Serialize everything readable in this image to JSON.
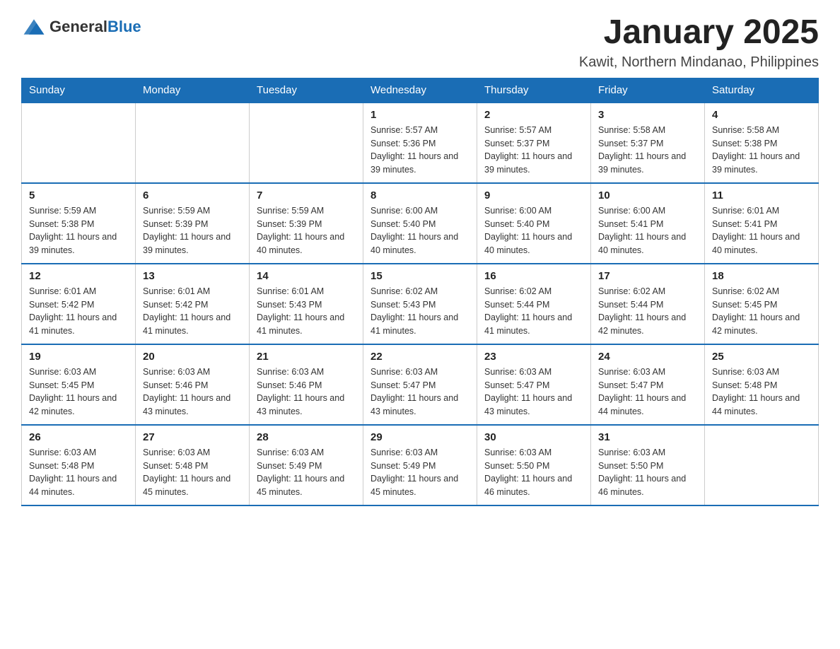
{
  "header": {
    "logo_general": "General",
    "logo_blue": "Blue",
    "month_title": "January 2025",
    "location": "Kawit, Northern Mindanao, Philippines"
  },
  "weekdays": [
    "Sunday",
    "Monday",
    "Tuesday",
    "Wednesday",
    "Thursday",
    "Friday",
    "Saturday"
  ],
  "weeks": [
    [
      {
        "day": "",
        "info": ""
      },
      {
        "day": "",
        "info": ""
      },
      {
        "day": "",
        "info": ""
      },
      {
        "day": "1",
        "info": "Sunrise: 5:57 AM\nSunset: 5:36 PM\nDaylight: 11 hours and 39 minutes."
      },
      {
        "day": "2",
        "info": "Sunrise: 5:57 AM\nSunset: 5:37 PM\nDaylight: 11 hours and 39 minutes."
      },
      {
        "day": "3",
        "info": "Sunrise: 5:58 AM\nSunset: 5:37 PM\nDaylight: 11 hours and 39 minutes."
      },
      {
        "day": "4",
        "info": "Sunrise: 5:58 AM\nSunset: 5:38 PM\nDaylight: 11 hours and 39 minutes."
      }
    ],
    [
      {
        "day": "5",
        "info": "Sunrise: 5:59 AM\nSunset: 5:38 PM\nDaylight: 11 hours and 39 minutes."
      },
      {
        "day": "6",
        "info": "Sunrise: 5:59 AM\nSunset: 5:39 PM\nDaylight: 11 hours and 39 minutes."
      },
      {
        "day": "7",
        "info": "Sunrise: 5:59 AM\nSunset: 5:39 PM\nDaylight: 11 hours and 40 minutes."
      },
      {
        "day": "8",
        "info": "Sunrise: 6:00 AM\nSunset: 5:40 PM\nDaylight: 11 hours and 40 minutes."
      },
      {
        "day": "9",
        "info": "Sunrise: 6:00 AM\nSunset: 5:40 PM\nDaylight: 11 hours and 40 minutes."
      },
      {
        "day": "10",
        "info": "Sunrise: 6:00 AM\nSunset: 5:41 PM\nDaylight: 11 hours and 40 minutes."
      },
      {
        "day": "11",
        "info": "Sunrise: 6:01 AM\nSunset: 5:41 PM\nDaylight: 11 hours and 40 minutes."
      }
    ],
    [
      {
        "day": "12",
        "info": "Sunrise: 6:01 AM\nSunset: 5:42 PM\nDaylight: 11 hours and 41 minutes."
      },
      {
        "day": "13",
        "info": "Sunrise: 6:01 AM\nSunset: 5:42 PM\nDaylight: 11 hours and 41 minutes."
      },
      {
        "day": "14",
        "info": "Sunrise: 6:01 AM\nSunset: 5:43 PM\nDaylight: 11 hours and 41 minutes."
      },
      {
        "day": "15",
        "info": "Sunrise: 6:02 AM\nSunset: 5:43 PM\nDaylight: 11 hours and 41 minutes."
      },
      {
        "day": "16",
        "info": "Sunrise: 6:02 AM\nSunset: 5:44 PM\nDaylight: 11 hours and 41 minutes."
      },
      {
        "day": "17",
        "info": "Sunrise: 6:02 AM\nSunset: 5:44 PM\nDaylight: 11 hours and 42 minutes."
      },
      {
        "day": "18",
        "info": "Sunrise: 6:02 AM\nSunset: 5:45 PM\nDaylight: 11 hours and 42 minutes."
      }
    ],
    [
      {
        "day": "19",
        "info": "Sunrise: 6:03 AM\nSunset: 5:45 PM\nDaylight: 11 hours and 42 minutes."
      },
      {
        "day": "20",
        "info": "Sunrise: 6:03 AM\nSunset: 5:46 PM\nDaylight: 11 hours and 43 minutes."
      },
      {
        "day": "21",
        "info": "Sunrise: 6:03 AM\nSunset: 5:46 PM\nDaylight: 11 hours and 43 minutes."
      },
      {
        "day": "22",
        "info": "Sunrise: 6:03 AM\nSunset: 5:47 PM\nDaylight: 11 hours and 43 minutes."
      },
      {
        "day": "23",
        "info": "Sunrise: 6:03 AM\nSunset: 5:47 PM\nDaylight: 11 hours and 43 minutes."
      },
      {
        "day": "24",
        "info": "Sunrise: 6:03 AM\nSunset: 5:47 PM\nDaylight: 11 hours and 44 minutes."
      },
      {
        "day": "25",
        "info": "Sunrise: 6:03 AM\nSunset: 5:48 PM\nDaylight: 11 hours and 44 minutes."
      }
    ],
    [
      {
        "day": "26",
        "info": "Sunrise: 6:03 AM\nSunset: 5:48 PM\nDaylight: 11 hours and 44 minutes."
      },
      {
        "day": "27",
        "info": "Sunrise: 6:03 AM\nSunset: 5:48 PM\nDaylight: 11 hours and 45 minutes."
      },
      {
        "day": "28",
        "info": "Sunrise: 6:03 AM\nSunset: 5:49 PM\nDaylight: 11 hours and 45 minutes."
      },
      {
        "day": "29",
        "info": "Sunrise: 6:03 AM\nSunset: 5:49 PM\nDaylight: 11 hours and 45 minutes."
      },
      {
        "day": "30",
        "info": "Sunrise: 6:03 AM\nSunset: 5:50 PM\nDaylight: 11 hours and 46 minutes."
      },
      {
        "day": "31",
        "info": "Sunrise: 6:03 AM\nSunset: 5:50 PM\nDaylight: 11 hours and 46 minutes."
      },
      {
        "day": "",
        "info": ""
      }
    ]
  ]
}
